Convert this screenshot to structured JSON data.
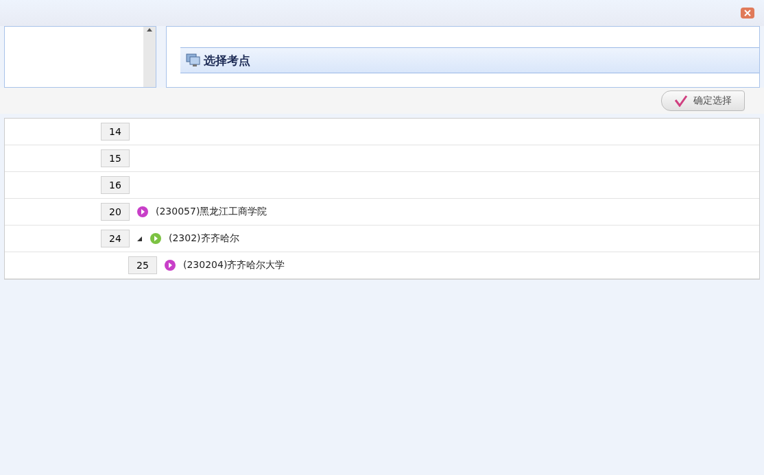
{
  "panel": {
    "title": "选择考点",
    "confirm_button": "确定选择"
  },
  "rows": [
    {
      "number": "14"
    },
    {
      "number": "15"
    },
    {
      "number": "16"
    },
    {
      "number": "20",
      "kind": "site",
      "label": "(230057)黑龙江工商学院"
    },
    {
      "number": "24",
      "kind": "city",
      "label": "(2302)齐齐哈尔",
      "expanded": true,
      "children": [
        {
          "number": "25",
          "kind": "site",
          "label": "(230204)齐齐哈尔大学"
        }
      ]
    }
  ]
}
